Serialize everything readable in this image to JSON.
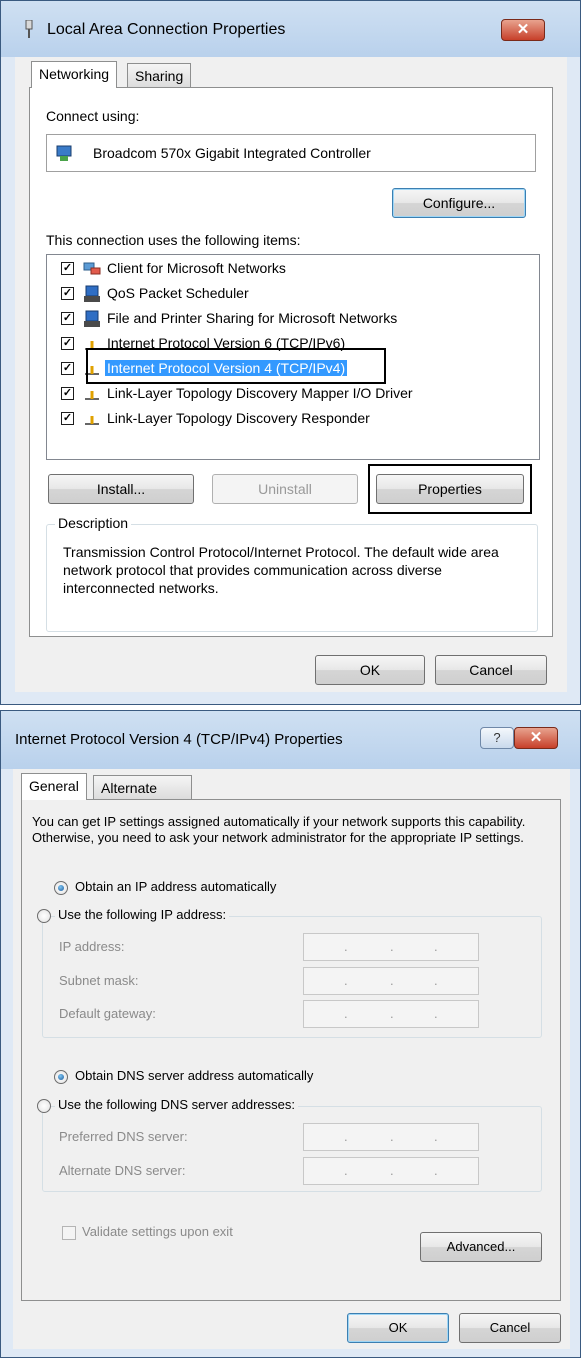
{
  "window1": {
    "title": "Local Area Connection Properties",
    "close_label": "✕",
    "tabs": [
      "Networking",
      "Sharing"
    ],
    "connect_using_label": "Connect using:",
    "adapter_name": "Broadcom 570x Gigabit Integrated Controller",
    "configure_label": "Configure...",
    "items_label": "This connection uses the following items:",
    "items": [
      {
        "label": "Client for Microsoft Networks",
        "checked": true,
        "icon": "network-client-icon"
      },
      {
        "label": "QoS Packet Scheduler",
        "checked": true,
        "icon": "service-icon"
      },
      {
        "label": "File and Printer Sharing for Microsoft Networks",
        "checked": true,
        "icon": "service-icon"
      },
      {
        "label": "Internet Protocol Version 6 (TCP/IPv6)",
        "checked": true,
        "icon": "protocol-icon"
      },
      {
        "label": "Internet Protocol Version 4 (TCP/IPv4)",
        "checked": true,
        "icon": "protocol-icon",
        "selected": true
      },
      {
        "label": "Link-Layer Topology Discovery Mapper I/O Driver",
        "checked": true,
        "icon": "protocol-icon"
      },
      {
        "label": "Link-Layer Topology Discovery Responder",
        "checked": true,
        "icon": "protocol-icon"
      }
    ],
    "install_label": "Install...",
    "uninstall_label": "Uninstall",
    "properties_label": "Properties",
    "description_legend": "Description",
    "description_text": "Transmission Control Protocol/Internet Protocol. The default wide area network protocol that provides communication across diverse interconnected networks.",
    "ok_label": "OK",
    "cancel_label": "Cancel"
  },
  "window2": {
    "title": "Internet Protocol Version 4 (TCP/IPv4) Properties",
    "help_label": "?",
    "close_label": "✕",
    "tabs": [
      "General",
      "Alternate Configuration"
    ],
    "intro_text": "You can get IP settings assigned automatically if your network supports this capability. Otherwise, you need to ask your network administrator for the appropriate IP settings.",
    "obtain_ip_auto": "Obtain an IP address automatically",
    "use_following_ip": "Use the following IP address:",
    "ip_address_label": "IP address:",
    "subnet_mask_label": "Subnet mask:",
    "default_gateway_label": "Default gateway:",
    "obtain_dns_auto": "Obtain DNS server address automatically",
    "use_following_dns": "Use the following DNS server addresses:",
    "preferred_dns_label": "Preferred DNS server:",
    "alternate_dns_label": "Alternate DNS server:",
    "ip_dot": ".",
    "validate_label": "Validate settings upon exit",
    "advanced_label": "Advanced...",
    "ok_label": "OK",
    "cancel_label": "Cancel"
  }
}
